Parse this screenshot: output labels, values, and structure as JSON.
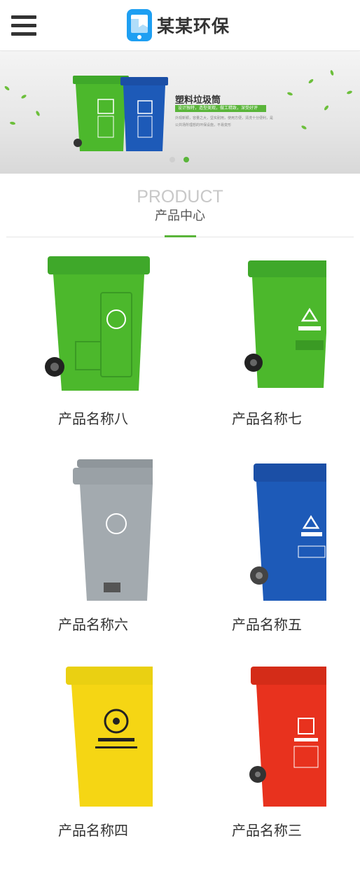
{
  "header": {
    "logo_text": "某某环保",
    "menu_icon": "hamburger-menu-icon",
    "logo_icon": "phone-logo-icon",
    "brand_color": "#1e9ff2"
  },
  "banner": {
    "title": "塑料垃圾筒",
    "tagline": "设计独特，造型美观，做工精致，深受好评",
    "description": "外观新颖，容量之大，坚实耐用，使用方便，清洗十分便利，是公共场所理想的环保设施，不易变形",
    "active_slide": 2,
    "slide_count": 2,
    "accent_color": "#5ab53a"
  },
  "section": {
    "title_en": "PRODUCT",
    "title_cn": "产品中心"
  },
  "products": [
    {
      "name": "产品名称八",
      "color": "#4cb82c"
    },
    {
      "name": "产品名称七",
      "color": "#4cb82c"
    },
    {
      "name": "产品名称六",
      "color": "#9aa1a6"
    },
    {
      "name": "产品名称五",
      "color": "#1d5ab8"
    },
    {
      "name": "产品名称四",
      "color": "#f5d010"
    },
    {
      "name": "产品名称三",
      "color": "#e8321e"
    }
  ]
}
